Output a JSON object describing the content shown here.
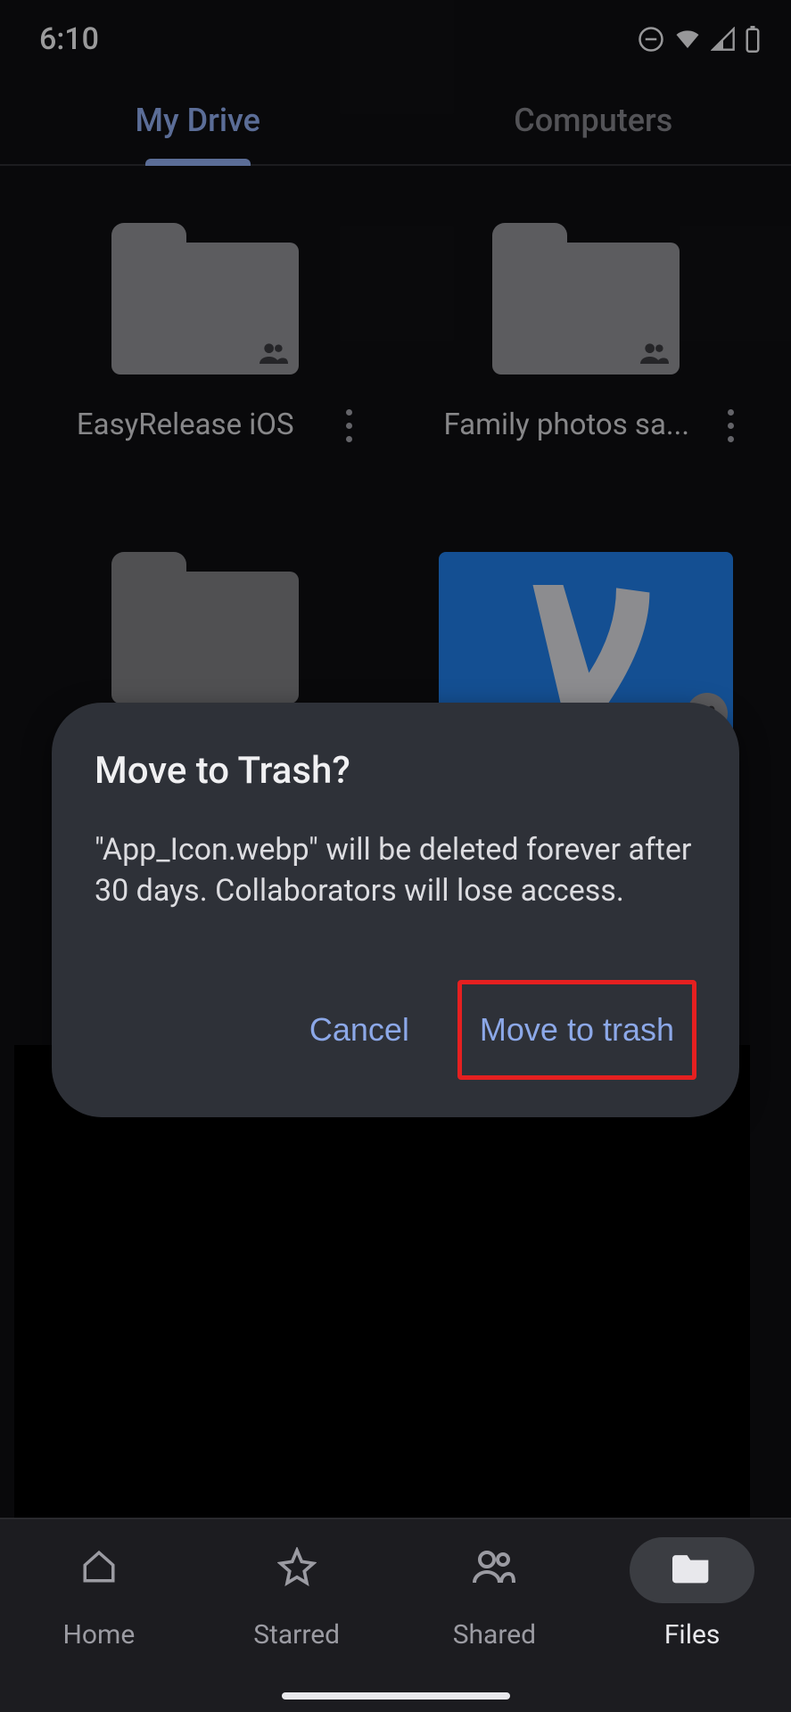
{
  "status": {
    "time": "6:10"
  },
  "tabs": {
    "my_drive": "My Drive",
    "computers": "Computers"
  },
  "files": [
    {
      "name": "EasyRelease iOS",
      "type": "folder",
      "shared": true
    },
    {
      "name": "Family photos sa...",
      "type": "folder",
      "shared": true
    },
    {
      "name": "",
      "type": "folder",
      "shared": false
    },
    {
      "name": "",
      "type": "image",
      "shared": true
    }
  ],
  "dialog": {
    "title": "Move to Trash?",
    "body": "\"App_Icon.webp\" will be deleted forever after 30 days. Collaborators will lose access.",
    "cancel": "Cancel",
    "confirm": "Move to trash"
  },
  "nav": {
    "home": "Home",
    "starred": "Starred",
    "shared": "Shared",
    "files": "Files"
  }
}
